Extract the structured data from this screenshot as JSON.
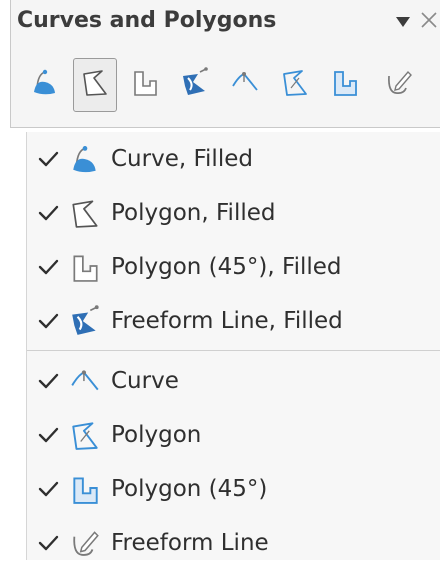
{
  "toolbar": {
    "title": "Curves and Polygons",
    "tools": [
      {
        "icon": "curve-filled-icon",
        "selected": false
      },
      {
        "icon": "polygon-filled-icon",
        "selected": true
      },
      {
        "icon": "polygon-45-filled-icon",
        "selected": false
      },
      {
        "icon": "freeform-line-filled-icon",
        "selected": false
      },
      {
        "icon": "curve-icon",
        "selected": false
      },
      {
        "icon": "polygon-icon",
        "selected": false
      },
      {
        "icon": "polygon-45-icon",
        "selected": false
      },
      {
        "icon": "freeform-line-icon",
        "selected": false
      }
    ]
  },
  "menu": {
    "items": [
      {
        "label": "Curve, Filled",
        "checked": true,
        "icon": "curve-filled-icon"
      },
      {
        "label": "Polygon, Filled",
        "checked": true,
        "icon": "polygon-filled-icon"
      },
      {
        "label": "Polygon (45°), Filled",
        "checked": true,
        "icon": "polygon-45-filled-icon"
      },
      {
        "label": "Freeform Line, Filled",
        "checked": true,
        "icon": "freeform-line-filled-icon"
      },
      {
        "label": "Curve",
        "checked": true,
        "icon": "curve-icon"
      },
      {
        "label": "Polygon",
        "checked": true,
        "icon": "polygon-icon"
      },
      {
        "label": "Polygon (45°)",
        "checked": true,
        "icon": "polygon-45-icon"
      },
      {
        "label": "Freeform Line",
        "checked": true,
        "icon": "freeform-line-icon"
      }
    ]
  },
  "colors": {
    "accent_blue": "#3a8fd6",
    "icon_gray": "#7a7a7a",
    "text": "#2f2f2f"
  }
}
